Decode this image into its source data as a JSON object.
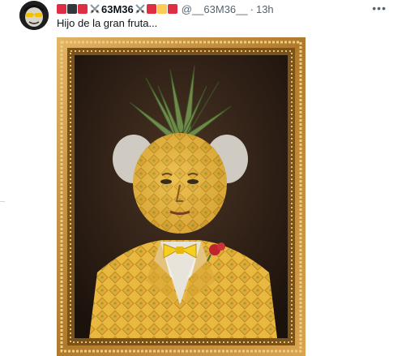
{
  "tweet": {
    "display_name": "63M36",
    "handle": "@__63M36__",
    "separator": "·",
    "time": "13h",
    "text": "Hijo de la gran fruta...",
    "more_icon": "more-horizontal-icon",
    "name_emojis_before": [
      "red",
      "black",
      "red",
      "swords"
    ],
    "name_emojis_after": [
      "swords",
      "red",
      "yellow",
      "red"
    ]
  },
  "colors": {
    "red": "#dd2e44",
    "yellow": "#fdcb58",
    "black": "#31373d",
    "frame_gold": "#c8923a",
    "background_dark": "#2b1c14"
  },
  "media": {
    "description_icon": "pineapple-portrait-image"
  }
}
